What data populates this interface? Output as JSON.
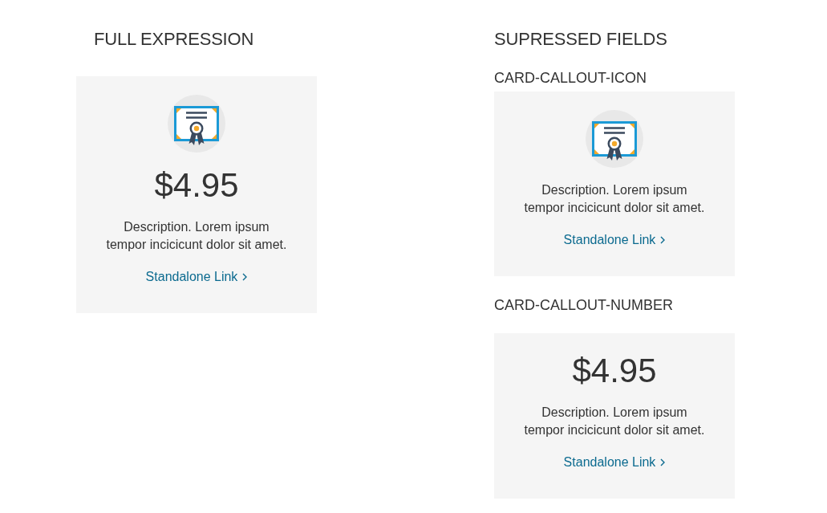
{
  "sections": [
    {
      "title": "FULL EXPRESSION",
      "groups": [
        {
          "card": {
            "kind": "full",
            "price": "$4.95",
            "description": "Description. Lorem ipsum tempor incicicunt dolor sit amet.",
            "link": "Standalone Link"
          }
        }
      ]
    },
    {
      "title": "SUPRESSED FIELDS",
      "groups": [
        {
          "label": "CARD-CALLOUT-ICON",
          "card": {
            "kind": "icon",
            "description": "Description. Lorem ipsum tempor incicicunt dolor sit amet.",
            "link": "Standalone Link"
          }
        },
        {
          "label": "CARD-CALLOUT-NUMBER",
          "card": {
            "kind": "number",
            "price": "$4.95",
            "description": "Description. Lorem ipsum tempor incicicunt dolor sit amet.",
            "link": "Standalone Link"
          }
        }
      ]
    }
  ]
}
